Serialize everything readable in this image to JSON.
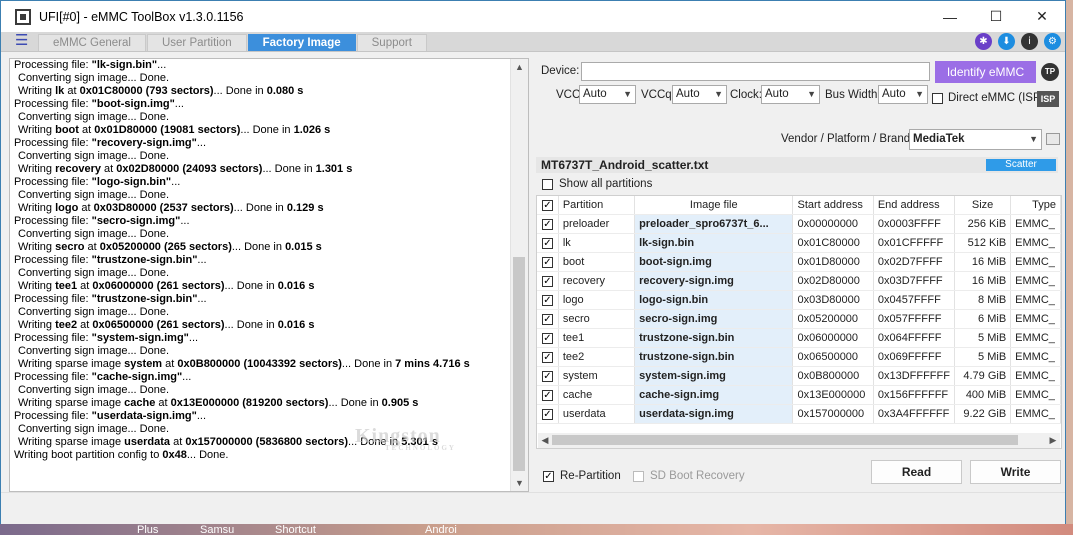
{
  "window": {
    "title": "UFI[#0] - eMMC ToolBox v1.3.0.1156",
    "minimize": "—",
    "maximize": "☐",
    "close": "✕"
  },
  "tabs": [
    {
      "label": "eMMC General"
    },
    {
      "label": "User Partition"
    },
    {
      "label": "Factory Image"
    },
    {
      "label": "Support"
    }
  ],
  "toolbar_icons": [
    "network-icon",
    "download-icon",
    "info-icon",
    "settings-icon"
  ],
  "log": [
    {
      "parts": [
        [
          "Processing file: ",
          false
        ],
        [
          "\"lk-sign.bin\"",
          true
        ],
        [
          "...",
          false
        ]
      ]
    },
    {
      "parts": [
        [
          "Converting sign image... Done.",
          false
        ]
      ],
      "indent": true
    },
    {
      "parts": [
        [
          "Writing ",
          false
        ],
        [
          "lk",
          true
        ],
        [
          " at ",
          false
        ],
        [
          "0x01C80000 (793 sectors)",
          true
        ],
        [
          "... Done in ",
          false
        ],
        [
          "0.080 s",
          true
        ]
      ],
      "indent": true
    },
    {
      "parts": [
        [
          "Processing file: ",
          false
        ],
        [
          "\"boot-sign.img\"",
          true
        ],
        [
          "...",
          false
        ]
      ]
    },
    {
      "parts": [
        [
          "Converting sign image... Done.",
          false
        ]
      ],
      "indent": true
    },
    {
      "parts": [
        [
          "Writing ",
          false
        ],
        [
          "boot",
          true
        ],
        [
          " at ",
          false
        ],
        [
          "0x01D80000 (19081 sectors)",
          true
        ],
        [
          "... Done in ",
          false
        ],
        [
          "1.026 s",
          true
        ]
      ],
      "indent": true
    },
    {
      "parts": [
        [
          "Processing file: ",
          false
        ],
        [
          "\"recovery-sign.img\"",
          true
        ],
        [
          "...",
          false
        ]
      ]
    },
    {
      "parts": [
        [
          "Converting sign image... Done.",
          false
        ]
      ],
      "indent": true
    },
    {
      "parts": [
        [
          "Writing ",
          false
        ],
        [
          "recovery",
          true
        ],
        [
          " at ",
          false
        ],
        [
          "0x02D80000 (24093 sectors)",
          true
        ],
        [
          "... Done in ",
          false
        ],
        [
          "1.301 s",
          true
        ]
      ],
      "indent": true
    },
    {
      "parts": [
        [
          "Processing file: ",
          false
        ],
        [
          "\"logo-sign.bin\"",
          true
        ],
        [
          "...",
          false
        ]
      ]
    },
    {
      "parts": [
        [
          "Converting sign image... Done.",
          false
        ]
      ],
      "indent": true
    },
    {
      "parts": [
        [
          "Writing ",
          false
        ],
        [
          "logo",
          true
        ],
        [
          " at ",
          false
        ],
        [
          "0x03D80000 (2537 sectors)",
          true
        ],
        [
          "... Done in ",
          false
        ],
        [
          "0.129 s",
          true
        ]
      ],
      "indent": true
    },
    {
      "parts": [
        [
          "Processing file: ",
          false
        ],
        [
          "\"secro-sign.img\"",
          true
        ],
        [
          "...",
          false
        ]
      ]
    },
    {
      "parts": [
        [
          "Converting sign image... Done.",
          false
        ]
      ],
      "indent": true
    },
    {
      "parts": [
        [
          "Writing ",
          false
        ],
        [
          "secro",
          true
        ],
        [
          " at ",
          false
        ],
        [
          "0x05200000 (265 sectors)",
          true
        ],
        [
          "... Done in ",
          false
        ],
        [
          "0.015 s",
          true
        ]
      ],
      "indent": true
    },
    {
      "parts": [
        [
          "Processing file: ",
          false
        ],
        [
          "\"trustzone-sign.bin\"",
          true
        ],
        [
          "...",
          false
        ]
      ]
    },
    {
      "parts": [
        [
          "Converting sign image... Done.",
          false
        ]
      ],
      "indent": true
    },
    {
      "parts": [
        [
          "Writing ",
          false
        ],
        [
          "tee1",
          true
        ],
        [
          " at ",
          false
        ],
        [
          "0x06000000 (261 sectors)",
          true
        ],
        [
          "... Done in ",
          false
        ],
        [
          "0.016 s",
          true
        ]
      ],
      "indent": true
    },
    {
      "parts": [
        [
          "Processing file: ",
          false
        ],
        [
          "\"trustzone-sign.bin\"",
          true
        ],
        [
          "...",
          false
        ]
      ]
    },
    {
      "parts": [
        [
          "Converting sign image... Done.",
          false
        ]
      ],
      "indent": true
    },
    {
      "parts": [
        [
          "Writing ",
          false
        ],
        [
          "tee2",
          true
        ],
        [
          " at ",
          false
        ],
        [
          "0x06500000 (261 sectors)",
          true
        ],
        [
          "... Done in ",
          false
        ],
        [
          "0.016 s",
          true
        ]
      ],
      "indent": true
    },
    {
      "parts": [
        [
          "Processing file: ",
          false
        ],
        [
          "\"system-sign.img\"",
          true
        ],
        [
          "...",
          false
        ]
      ]
    },
    {
      "parts": [
        [
          "Converting sign image... Done.",
          false
        ]
      ],
      "indent": true
    },
    {
      "parts": [
        [
          "Writing sparse image ",
          false
        ],
        [
          "system",
          true
        ],
        [
          " at ",
          false
        ],
        [
          "0x0B800000 (10043392 sectors)",
          true
        ],
        [
          "... Done in ",
          false
        ],
        [
          "7 mins 4.716 s",
          true
        ]
      ],
      "indent": true
    },
    {
      "parts": [
        [
          "Processing file: ",
          false
        ],
        [
          "\"cache-sign.img\"",
          true
        ],
        [
          "...",
          false
        ]
      ]
    },
    {
      "parts": [
        [
          "Converting sign image... Done.",
          false
        ]
      ],
      "indent": true
    },
    {
      "parts": [
        [
          "Writing sparse image ",
          false
        ],
        [
          "cache",
          true
        ],
        [
          " at ",
          false
        ],
        [
          "0x13E000000 (819200 sectors)",
          true
        ],
        [
          "... Done in ",
          false
        ],
        [
          "0.905 s",
          true
        ]
      ],
      "indent": true
    },
    {
      "parts": [
        [
          "Processing file: ",
          false
        ],
        [
          "\"userdata-sign.img\"",
          true
        ],
        [
          "...",
          false
        ]
      ]
    },
    {
      "parts": [
        [
          "Converting sign image... Done.",
          false
        ]
      ],
      "indent": true
    },
    {
      "parts": [
        [
          "Writing sparse image ",
          false
        ],
        [
          "userdata",
          true
        ],
        [
          " at ",
          false
        ],
        [
          "0x157000000 (5836800 sectors)",
          true
        ],
        [
          "... Done in ",
          false
        ],
        [
          "5.301 s",
          true
        ]
      ],
      "indent": true
    },
    {
      "parts": [
        [
          "Writing boot partition config to ",
          false
        ],
        [
          "0x48",
          true
        ],
        [
          "... Done.",
          false
        ]
      ]
    }
  ],
  "watermark": {
    "brand": "Kingston",
    "sub": "TECHNOLOGY"
  },
  "device": {
    "label": "Device:",
    "value": "",
    "identify_label": "Identify eMMC",
    "tp_label": "TP"
  },
  "options": {
    "vcc_label": "VCC:",
    "vcc_value": "Auto",
    "vccq_label": "VCCq:",
    "vccq_value": "Auto",
    "clock_label": "Clock:",
    "clock_value": "Auto",
    "buswidth_label": "Bus Width:",
    "buswidth_value": "Auto",
    "direct_label": "Direct eMMC (ISP)",
    "direct_checked": false,
    "isp_label": "ISP"
  },
  "vendor": {
    "label": "Vendor / Platform / Brand:",
    "value": "MediaTek"
  },
  "scatter": {
    "file": "MT6737T_Android_scatter.txt",
    "tag": "Scatter"
  },
  "show_all": {
    "label": "Show all partitions",
    "checked": false
  },
  "partition_table": {
    "headers": {
      "partition": "Partition",
      "image": "Image file",
      "start": "Start address",
      "end": "End address",
      "size": "Size",
      "type": "Type"
    },
    "rows": [
      {
        "checked": true,
        "partition": "preloader",
        "image": "preloader_spro6737t_6...",
        "start": "0x00000000",
        "end": "0x0003FFFF",
        "size": "256 KiB",
        "type": "EMMC_"
      },
      {
        "checked": true,
        "partition": "lk",
        "image": "lk-sign.bin",
        "start": "0x01C80000",
        "end": "0x01CFFFFF",
        "size": "512 KiB",
        "type": "EMMC_"
      },
      {
        "checked": true,
        "partition": "boot",
        "image": "boot-sign.img",
        "start": "0x01D80000",
        "end": "0x02D7FFFF",
        "size": "16 MiB",
        "type": "EMMC_"
      },
      {
        "checked": true,
        "partition": "recovery",
        "image": "recovery-sign.img",
        "start": "0x02D80000",
        "end": "0x03D7FFFF",
        "size": "16 MiB",
        "type": "EMMC_"
      },
      {
        "checked": true,
        "partition": "logo",
        "image": "logo-sign.bin",
        "start": "0x03D80000",
        "end": "0x0457FFFF",
        "size": "8 MiB",
        "type": "EMMC_"
      },
      {
        "checked": true,
        "partition": "secro",
        "image": "secro-sign.img",
        "start": "0x05200000",
        "end": "0x057FFFFF",
        "size": "6 MiB",
        "type": "EMMC_"
      },
      {
        "checked": true,
        "partition": "tee1",
        "image": "trustzone-sign.bin",
        "start": "0x06000000",
        "end": "0x064FFFFF",
        "size": "5 MiB",
        "type": "EMMC_"
      },
      {
        "checked": true,
        "partition": "tee2",
        "image": "trustzone-sign.bin",
        "start": "0x06500000",
        "end": "0x069FFFFF",
        "size": "5 MiB",
        "type": "EMMC_"
      },
      {
        "checked": true,
        "partition": "system",
        "image": "system-sign.img",
        "start": "0x0B800000",
        "end": "0x13DFFFFFF",
        "size": "4.79 GiB",
        "type": "EMMC_"
      },
      {
        "checked": true,
        "partition": "cache",
        "image": "cache-sign.img",
        "start": "0x13E000000",
        "end": "0x156FFFFFF",
        "size": "400 MiB",
        "type": "EMMC_"
      },
      {
        "checked": true,
        "partition": "userdata",
        "image": "userdata-sign.img",
        "start": "0x157000000",
        "end": "0x3A4FFFFFF",
        "size": "9.22 GiB",
        "type": "EMMC_"
      }
    ]
  },
  "bottom": {
    "repartition_label": "Re-Partition",
    "repartition_checked": true,
    "sdboot_label": "SD Boot Recovery",
    "sdboot_checked": false,
    "read_label": "Read",
    "write_label": "Write"
  },
  "taskbar": [
    "Plus",
    "Samsu",
    "Shortcut",
    "Androi"
  ],
  "colors": {
    "accent": "#3c8fdc",
    "identify": "#9b6ee6",
    "scatter_tag": "#2f9be8",
    "image_col": "#e3effa"
  }
}
